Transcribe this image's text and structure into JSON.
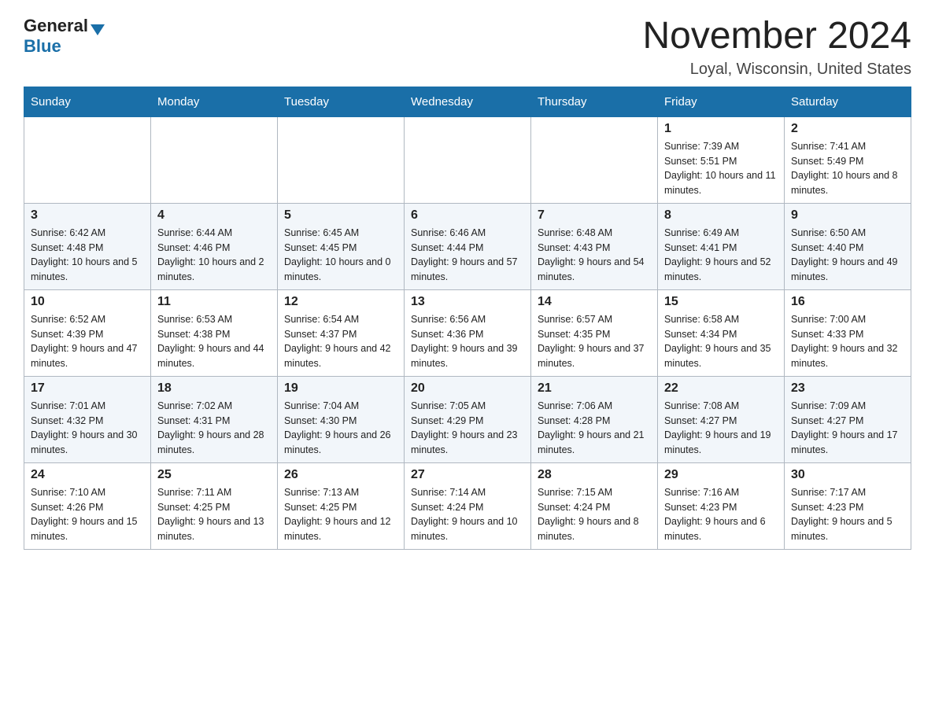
{
  "header": {
    "logo_general": "General",
    "logo_blue": "Blue",
    "month_title": "November 2024",
    "location": "Loyal, Wisconsin, United States"
  },
  "days_of_week": [
    "Sunday",
    "Monday",
    "Tuesday",
    "Wednesday",
    "Thursday",
    "Friday",
    "Saturday"
  ],
  "weeks": [
    [
      {
        "day": "",
        "info": ""
      },
      {
        "day": "",
        "info": ""
      },
      {
        "day": "",
        "info": ""
      },
      {
        "day": "",
        "info": ""
      },
      {
        "day": "",
        "info": ""
      },
      {
        "day": "1",
        "info": "Sunrise: 7:39 AM\nSunset: 5:51 PM\nDaylight: 10 hours and 11 minutes."
      },
      {
        "day": "2",
        "info": "Sunrise: 7:41 AM\nSunset: 5:49 PM\nDaylight: 10 hours and 8 minutes."
      }
    ],
    [
      {
        "day": "3",
        "info": "Sunrise: 6:42 AM\nSunset: 4:48 PM\nDaylight: 10 hours and 5 minutes."
      },
      {
        "day": "4",
        "info": "Sunrise: 6:44 AM\nSunset: 4:46 PM\nDaylight: 10 hours and 2 minutes."
      },
      {
        "day": "5",
        "info": "Sunrise: 6:45 AM\nSunset: 4:45 PM\nDaylight: 10 hours and 0 minutes."
      },
      {
        "day": "6",
        "info": "Sunrise: 6:46 AM\nSunset: 4:44 PM\nDaylight: 9 hours and 57 minutes."
      },
      {
        "day": "7",
        "info": "Sunrise: 6:48 AM\nSunset: 4:43 PM\nDaylight: 9 hours and 54 minutes."
      },
      {
        "day": "8",
        "info": "Sunrise: 6:49 AM\nSunset: 4:41 PM\nDaylight: 9 hours and 52 minutes."
      },
      {
        "day": "9",
        "info": "Sunrise: 6:50 AM\nSunset: 4:40 PM\nDaylight: 9 hours and 49 minutes."
      }
    ],
    [
      {
        "day": "10",
        "info": "Sunrise: 6:52 AM\nSunset: 4:39 PM\nDaylight: 9 hours and 47 minutes."
      },
      {
        "day": "11",
        "info": "Sunrise: 6:53 AM\nSunset: 4:38 PM\nDaylight: 9 hours and 44 minutes."
      },
      {
        "day": "12",
        "info": "Sunrise: 6:54 AM\nSunset: 4:37 PM\nDaylight: 9 hours and 42 minutes."
      },
      {
        "day": "13",
        "info": "Sunrise: 6:56 AM\nSunset: 4:36 PM\nDaylight: 9 hours and 39 minutes."
      },
      {
        "day": "14",
        "info": "Sunrise: 6:57 AM\nSunset: 4:35 PM\nDaylight: 9 hours and 37 minutes."
      },
      {
        "day": "15",
        "info": "Sunrise: 6:58 AM\nSunset: 4:34 PM\nDaylight: 9 hours and 35 minutes."
      },
      {
        "day": "16",
        "info": "Sunrise: 7:00 AM\nSunset: 4:33 PM\nDaylight: 9 hours and 32 minutes."
      }
    ],
    [
      {
        "day": "17",
        "info": "Sunrise: 7:01 AM\nSunset: 4:32 PM\nDaylight: 9 hours and 30 minutes."
      },
      {
        "day": "18",
        "info": "Sunrise: 7:02 AM\nSunset: 4:31 PM\nDaylight: 9 hours and 28 minutes."
      },
      {
        "day": "19",
        "info": "Sunrise: 7:04 AM\nSunset: 4:30 PM\nDaylight: 9 hours and 26 minutes."
      },
      {
        "day": "20",
        "info": "Sunrise: 7:05 AM\nSunset: 4:29 PM\nDaylight: 9 hours and 23 minutes."
      },
      {
        "day": "21",
        "info": "Sunrise: 7:06 AM\nSunset: 4:28 PM\nDaylight: 9 hours and 21 minutes."
      },
      {
        "day": "22",
        "info": "Sunrise: 7:08 AM\nSunset: 4:27 PM\nDaylight: 9 hours and 19 minutes."
      },
      {
        "day": "23",
        "info": "Sunrise: 7:09 AM\nSunset: 4:27 PM\nDaylight: 9 hours and 17 minutes."
      }
    ],
    [
      {
        "day": "24",
        "info": "Sunrise: 7:10 AM\nSunset: 4:26 PM\nDaylight: 9 hours and 15 minutes."
      },
      {
        "day": "25",
        "info": "Sunrise: 7:11 AM\nSunset: 4:25 PM\nDaylight: 9 hours and 13 minutes."
      },
      {
        "day": "26",
        "info": "Sunrise: 7:13 AM\nSunset: 4:25 PM\nDaylight: 9 hours and 12 minutes."
      },
      {
        "day": "27",
        "info": "Sunrise: 7:14 AM\nSunset: 4:24 PM\nDaylight: 9 hours and 10 minutes."
      },
      {
        "day": "28",
        "info": "Sunrise: 7:15 AM\nSunset: 4:24 PM\nDaylight: 9 hours and 8 minutes."
      },
      {
        "day": "29",
        "info": "Sunrise: 7:16 AM\nSunset: 4:23 PM\nDaylight: 9 hours and 6 minutes."
      },
      {
        "day": "30",
        "info": "Sunrise: 7:17 AM\nSunset: 4:23 PM\nDaylight: 9 hours and 5 minutes."
      }
    ]
  ]
}
